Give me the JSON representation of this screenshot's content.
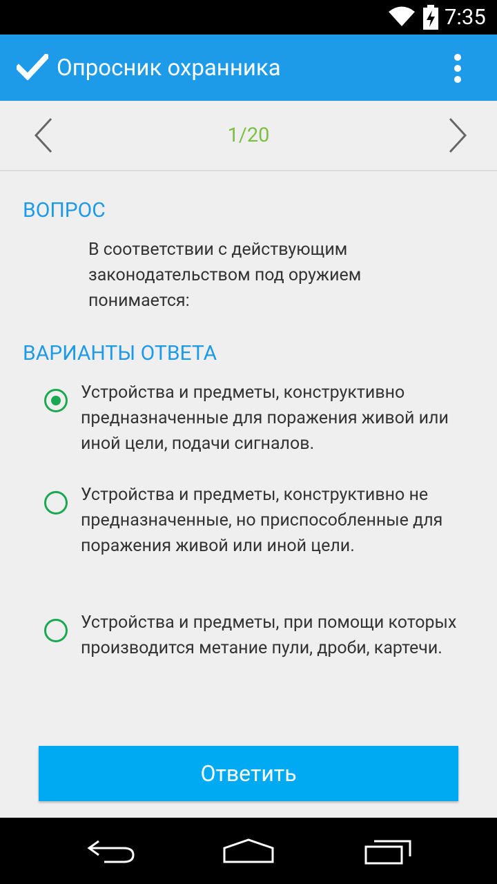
{
  "status_bar": {
    "time": "7:35",
    "icons": [
      "wifi-icon",
      "battery-charging-icon"
    ]
  },
  "action_bar": {
    "title": "Опросник охранника",
    "app_icon": "checkmark-icon",
    "menu_icon": "overflow-menu-icon"
  },
  "pager": {
    "counter": "1/20",
    "counter_color": "#7bc043",
    "prev_icon": "chevron-left-icon",
    "next_icon": "chevron-right-icon"
  },
  "question": {
    "heading": "ВОПРОС",
    "text": "В соответствии с действующим законодательством под оружием понимается:"
  },
  "answers": {
    "heading": "ВАРИАНТЫ ОТВЕТА",
    "options": [
      {
        "label": "Устройства и предметы, конструктивно предназначенные для поражения живой или иной цели, подачи сигналов.",
        "selected": true
      },
      {
        "label": "Устройства и предметы, конструктивно не предназначенные, но приспособленные для поражения живой или иной цели.",
        "selected": false
      },
      {
        "label": "Устройства и предметы, при помощи которых производится метание пули, дроби, картечи.",
        "selected": false
      }
    ]
  },
  "submit_button": {
    "label": "Ответить"
  },
  "nav_bar": {
    "icons": [
      "back-icon",
      "home-icon",
      "recents-icon"
    ]
  },
  "colors": {
    "accent": "#1e9be8",
    "button": "#00aaf2",
    "radio": "#1aa850",
    "background": "#efefef"
  }
}
